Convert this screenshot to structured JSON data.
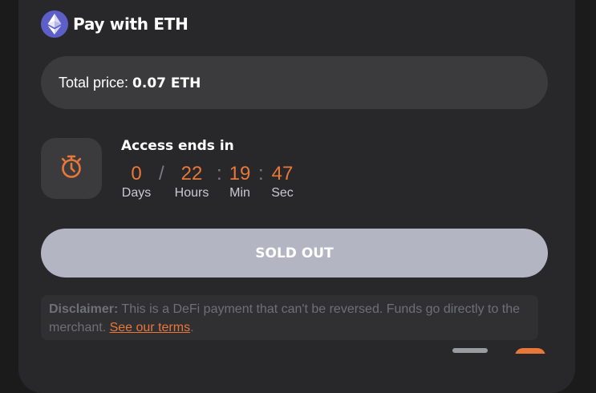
{
  "header": {
    "title": "Pay with ETH",
    "icon": "ethereum-logo",
    "icon_color": "#5b5fc7"
  },
  "price": {
    "label": "Total price: ",
    "value": "0.07 ETH"
  },
  "access": {
    "title": "Access ends in",
    "icon": "stopwatch-icon",
    "countdown": [
      {
        "value": "0",
        "label": "Days"
      },
      {
        "value": "22",
        "label": "Hours"
      },
      {
        "value": "19",
        "label": "Min"
      },
      {
        "value": "47",
        "label": "Sec"
      }
    ],
    "separators": [
      "/",
      ":",
      ":"
    ]
  },
  "button": {
    "label": "SOLD OUT"
  },
  "disclaimer": {
    "label": "Disclaimer:",
    "text": " This is a DeFi payment that can't be reversed. Funds go directly to the merchant. ",
    "link_text": "See our terms",
    "end": "."
  },
  "colors": {
    "accent": "#e8773a",
    "card_bg": "#28282a",
    "field_bg": "#3b3b3d",
    "button_disabled": "#b3b5c2"
  }
}
